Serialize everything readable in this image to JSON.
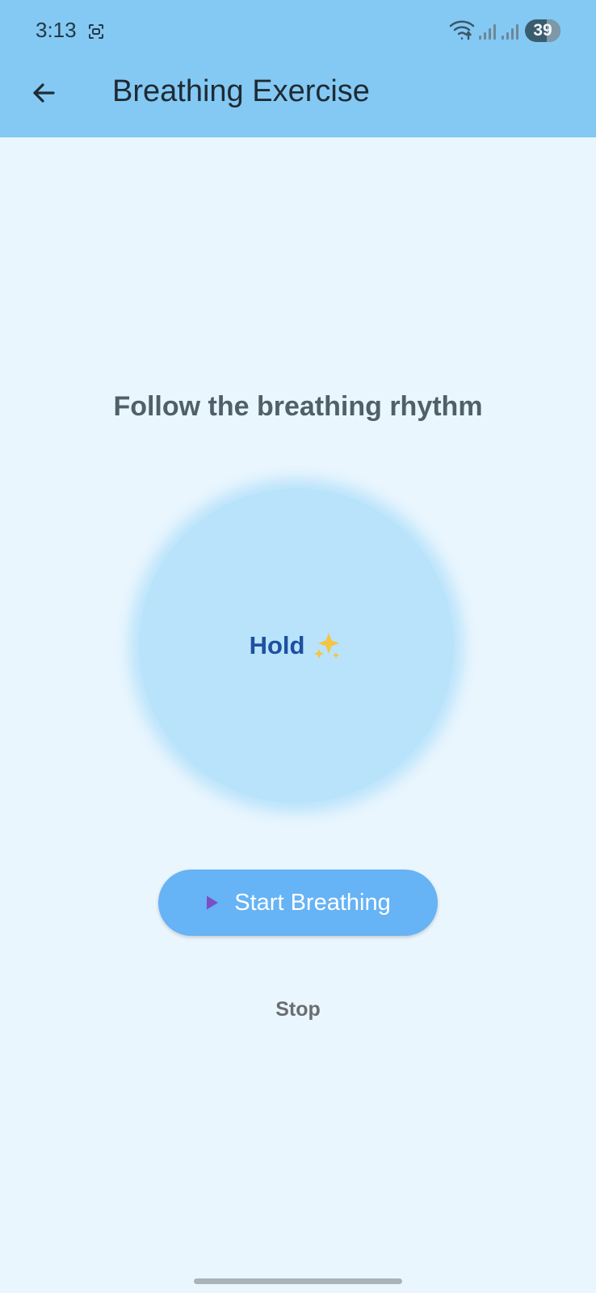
{
  "status_bar": {
    "time": "3:13",
    "battery_level": "39"
  },
  "app_bar": {
    "title": "Breathing Exercise"
  },
  "main": {
    "heading": "Follow the breathing rhythm",
    "phase": "Hold"
  },
  "actions": {
    "start_label": "Start Breathing",
    "stop_label": "Stop"
  },
  "icons": {
    "back": "back-arrow-icon",
    "play": "play-icon",
    "sparkles": "sparkles-icon",
    "wifi": "wifi-icon",
    "signal": "signal-icon",
    "screenshot": "screenshot-icon"
  },
  "colors": {
    "app_bar": "#83C9F3",
    "background": "#EAF6FE",
    "circle": "#B8E3FB",
    "phase_text": "#1E4FA0",
    "start_button": "#66B3F5",
    "play_icon": "#7B4FC5"
  }
}
